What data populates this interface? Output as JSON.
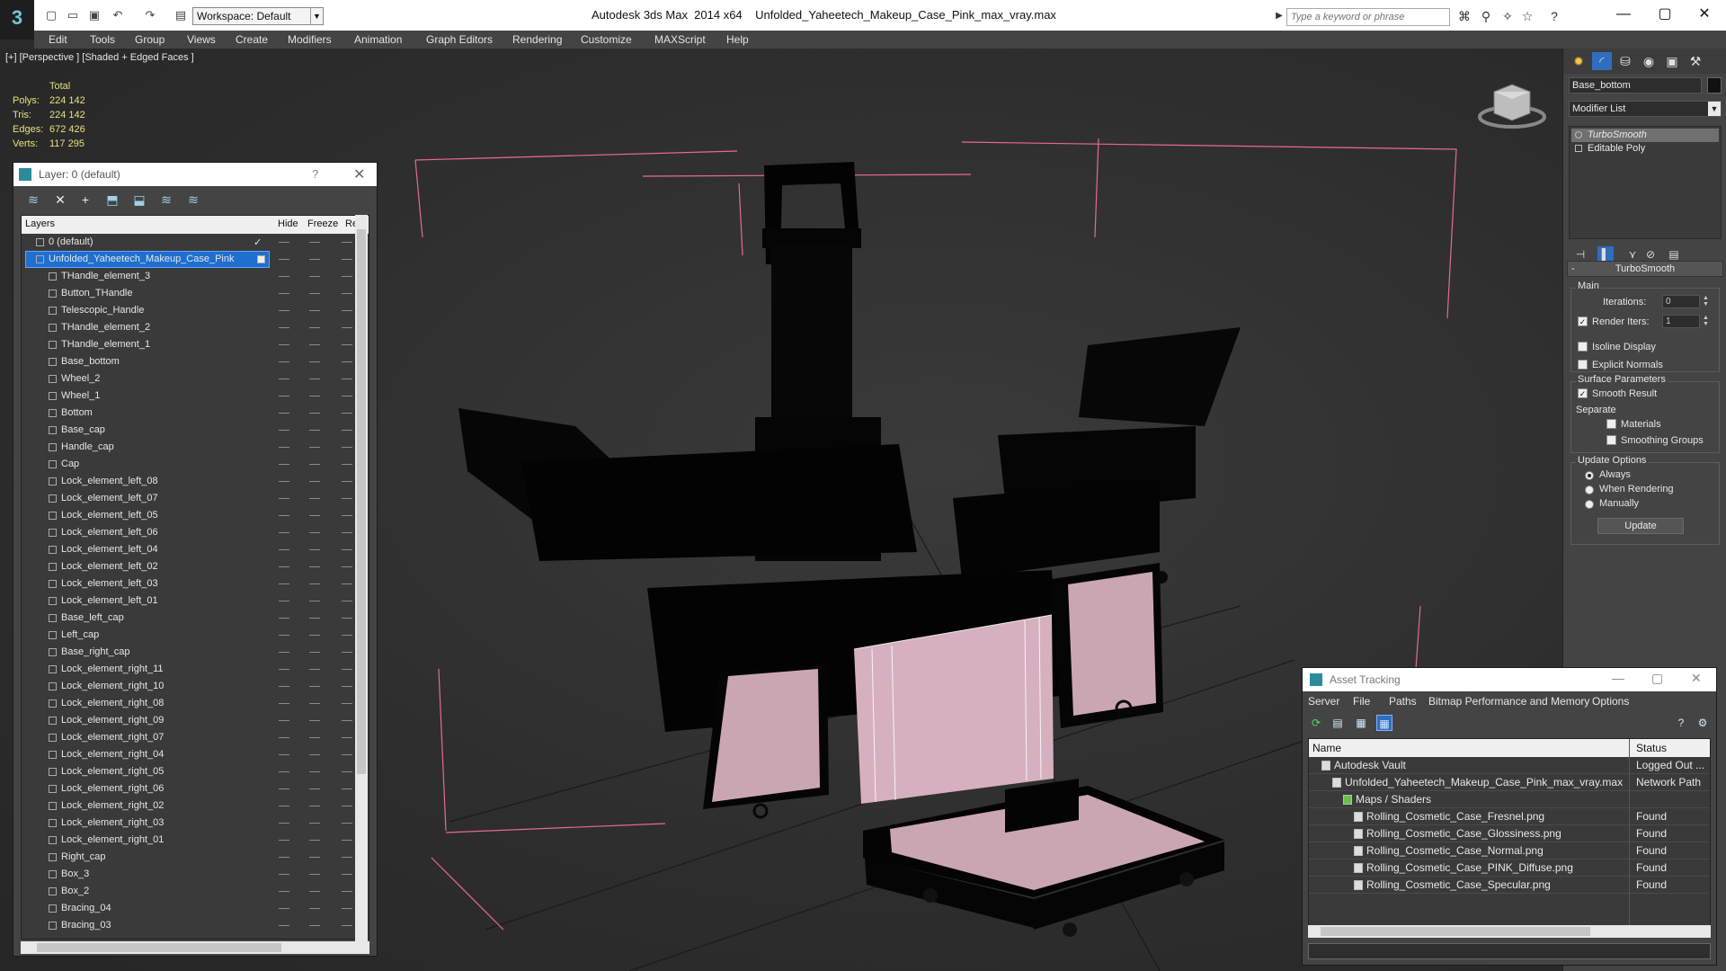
{
  "app": {
    "title": "Autodesk 3ds Max  2014 x64    Unfolded_Yaheetech_Makeup_Case_Pink_max_vray.max",
    "workspace": "Workspace: Default",
    "search_placeholder": "Type a keyword or phrase"
  },
  "menu": [
    "Edit",
    "Tools",
    "Group",
    "Views",
    "Create",
    "Modifiers",
    "Animation",
    "Graph Editors",
    "Rendering",
    "Customize",
    "MAXScript",
    "Help"
  ],
  "viewport": {
    "label": "[+] [Perspective ] [Shaded + Edged Faces ]",
    "stats": {
      "header": "Total",
      "rows": [
        {
          "k": "Polys:",
          "v": "224 142"
        },
        {
          "k": "Tris:",
          "v": "224 142"
        },
        {
          "k": "Edges:",
          "v": "672 426"
        },
        {
          "k": "Verts:",
          "v": "117 295"
        }
      ]
    },
    "colors": {
      "wire": "#e86a93",
      "surface": "#caa6b3",
      "body": "#030303",
      "grid": "#1a1a1a"
    }
  },
  "layer_dialog": {
    "title": "Layer: 0 (default)",
    "help": "?",
    "columns": [
      "Layers",
      "Hide",
      "Freeze",
      "Re"
    ],
    "layers": [
      {
        "name": "0 (default)",
        "level": 0,
        "checked": true
      },
      {
        "name": "Unfolded_Yaheetech_Makeup_Case_Pink",
        "level": 0,
        "selected": true
      },
      {
        "name": "THandle_element_3",
        "level": 1
      },
      {
        "name": "Button_THandle",
        "level": 1
      },
      {
        "name": "Telescopic_Handle",
        "level": 1
      },
      {
        "name": "THandle_element_2",
        "level": 1
      },
      {
        "name": "THandle_element_1",
        "level": 1
      },
      {
        "name": "Base_bottom",
        "level": 1
      },
      {
        "name": "Wheel_2",
        "level": 1
      },
      {
        "name": "Wheel_1",
        "level": 1
      },
      {
        "name": "Bottom",
        "level": 1
      },
      {
        "name": "Base_cap",
        "level": 1
      },
      {
        "name": "Handle_cap",
        "level": 1
      },
      {
        "name": "Cap",
        "level": 1
      },
      {
        "name": "Lock_element_left_08",
        "level": 1
      },
      {
        "name": "Lock_element_left_07",
        "level": 1
      },
      {
        "name": "Lock_element_left_05",
        "level": 1
      },
      {
        "name": "Lock_element_left_06",
        "level": 1
      },
      {
        "name": "Lock_element_left_04",
        "level": 1
      },
      {
        "name": "Lock_element_left_02",
        "level": 1
      },
      {
        "name": "Lock_element_left_03",
        "level": 1
      },
      {
        "name": "Lock_element_left_01",
        "level": 1
      },
      {
        "name": "Base_left_cap",
        "level": 1
      },
      {
        "name": "Left_cap",
        "level": 1
      },
      {
        "name": "Base_right_cap",
        "level": 1
      },
      {
        "name": "Lock_element_right_11",
        "level": 1
      },
      {
        "name": "Lock_element_right_10",
        "level": 1
      },
      {
        "name": "Lock_element_right_08",
        "level": 1
      },
      {
        "name": "Lock_element_right_09",
        "level": 1
      },
      {
        "name": "Lock_element_right_07",
        "level": 1
      },
      {
        "name": "Lock_element_right_04",
        "level": 1
      },
      {
        "name": "Lock_element_right_05",
        "level": 1
      },
      {
        "name": "Lock_element_right_06",
        "level": 1
      },
      {
        "name": "Lock_element_right_02",
        "level": 1
      },
      {
        "name": "Lock_element_right_03",
        "level": 1
      },
      {
        "name": "Lock_element_right_01",
        "level": 1
      },
      {
        "name": "Right_cap",
        "level": 1
      },
      {
        "name": "Box_3",
        "level": 1
      },
      {
        "name": "Box_2",
        "level": 1
      },
      {
        "name": "Bracing_04",
        "level": 1
      },
      {
        "name": "Bracing_03",
        "level": 1
      }
    ]
  },
  "command_panel": {
    "object_name": "Base_bottom",
    "modifier_list": "Modifier List",
    "stack": [
      "TurboSmooth",
      "Editable Poly"
    ],
    "rollout_title": "TurboSmooth",
    "rollout_toggle": "-",
    "main_group": "Main",
    "iterations_label": "Iterations:",
    "iterations_value": "0",
    "render_iters_label": "Render Iters:",
    "render_iters_value": "1",
    "isoline_label": "Isoline Display",
    "explicit_normals_label": "Explicit Normals",
    "surface_group": "Surface Parameters",
    "smooth_result_label": "Smooth Result",
    "separate_label": "Separate",
    "materials_label": "Materials",
    "smoothing_groups_label": "Smoothing Groups",
    "update_group": "Update Options",
    "always_label": "Always",
    "when_rendering_label": "When Rendering",
    "manually_label": "Manually",
    "update_button": "Update"
  },
  "asset_tracking": {
    "title": "Asset Tracking",
    "menu": [
      "Server",
      "File",
      "Paths",
      "Bitmap Performance and Memory",
      "Options"
    ],
    "columns": [
      "Name",
      "Status"
    ],
    "rows": [
      {
        "name": "Autodesk Vault",
        "status": "Logged Out ...",
        "level": 1
      },
      {
        "name": "Unfolded_Yaheetech_Makeup_Case_Pink_max_vray.max",
        "status": "Network Path",
        "level": 2
      },
      {
        "name": "Maps / Shaders",
        "status": "",
        "level": 3
      },
      {
        "name": "Rolling_Cosmetic_Case_Fresnel.png",
        "status": "Found",
        "level": 4
      },
      {
        "name": "Rolling_Cosmetic_Case_Glossiness.png",
        "status": "Found",
        "level": 4
      },
      {
        "name": "Rolling_Cosmetic_Case_Normal.png",
        "status": "Found",
        "level": 4
      },
      {
        "name": "Rolling_Cosmetic_Case_PINK_Diffuse.png",
        "status": "Found",
        "level": 4
      },
      {
        "name": "Rolling_Cosmetic_Case_Specular.png",
        "status": "Found",
        "level": 4
      }
    ]
  }
}
